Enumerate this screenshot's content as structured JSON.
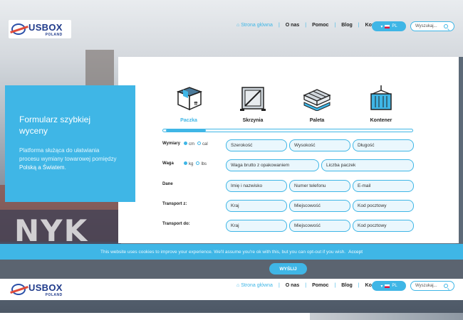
{
  "header": {
    "logo_brand": "USBOX",
    "logo_sub": "POLAND",
    "nav": [
      {
        "label": "Strona główna",
        "active": true
      },
      {
        "label": "O nas",
        "active": false
      },
      {
        "label": "Pomoc",
        "active": false
      },
      {
        "label": "Blog",
        "active": false
      },
      {
        "label": "Kontakt",
        "active": false
      }
    ],
    "lang": "PL",
    "search_placeholder": "Wyszukaj..."
  },
  "info": {
    "title": "Formularz szybkiej wyceny",
    "desc_prefix": "Platforma służąca do ułatwiania procesu wymiany towarowej pomiędzy",
    "desc_highlight": "Polską a Światem",
    "desc_suffix": "."
  },
  "types": [
    {
      "label": "Paczka",
      "icon": "box-icon",
      "active": true
    },
    {
      "label": "Skrzynia",
      "icon": "crate-icon",
      "active": false
    },
    {
      "label": "Paleta",
      "icon": "pallet-icon",
      "active": false
    },
    {
      "label": "Kontener",
      "icon": "container-icon",
      "active": false
    }
  ],
  "progress": 0.16,
  "form": {
    "dimensions": {
      "label": "Wymiary",
      "unit_a": "cm",
      "unit_b": "cal",
      "fields": [
        "Szerokość",
        "Wysokość",
        "Długość"
      ]
    },
    "weight": {
      "label": "Waga",
      "unit_a": "kg",
      "unit_b": "lbs",
      "fields": [
        "Waga brutto z opakowaniem",
        "Liczba paczek"
      ]
    },
    "data": {
      "label": "Dane",
      "fields": [
        "Imię i nazwisko",
        "Numer telefonu",
        "E-mail"
      ]
    },
    "from": {
      "label": "Transport z:",
      "fields": [
        "Kraj",
        "Miejscowość",
        "Kod pocztowy"
      ]
    },
    "to": {
      "label": "Transport do:",
      "fields": [
        "Kraj",
        "Miejscowość",
        "Kod pocztowy"
      ]
    }
  },
  "cookie": {
    "text": "This website uses cookies to improve your experience. We'll assume you're ok with this, but you can opt-out if you wish.",
    "accept": "Accept",
    "button": "WYŚLIJ"
  },
  "colors": {
    "accent": "#3fb6e6",
    "brand": "#1f3a8a"
  }
}
